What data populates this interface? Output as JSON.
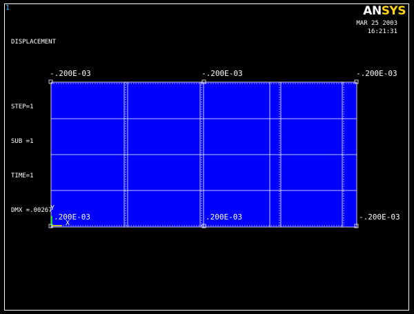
{
  "window": {
    "number": "1"
  },
  "result": {
    "title": "DISPLACEMENT",
    "lines": [
      "STEP=1",
      "SUB =1",
      "TIME=1",
      "DMX =.002674"
    ]
  },
  "brand": {
    "logo_part1": "AN",
    "logo_part2": "SYS",
    "logo_color": "#ffd21a"
  },
  "datetime": {
    "date": "MAR 25 2003",
    "time": "16:21:31"
  },
  "colors": {
    "mesh_fill": "#0000ff",
    "mesh_line": "#ffffff",
    "background": "#000000",
    "axis_y": "#00ff00",
    "axis_x": "#ffff00"
  },
  "labels": {
    "top_left": "-.200E-03",
    "top_mid": "-.200E-03",
    "top_right": "-.200E-03",
    "bot_left": ".200E-03",
    "bot_mid": ".200E-03",
    "bot_right": "-.200E-03"
  },
  "triad": {
    "y": "Y",
    "x": "X"
  }
}
